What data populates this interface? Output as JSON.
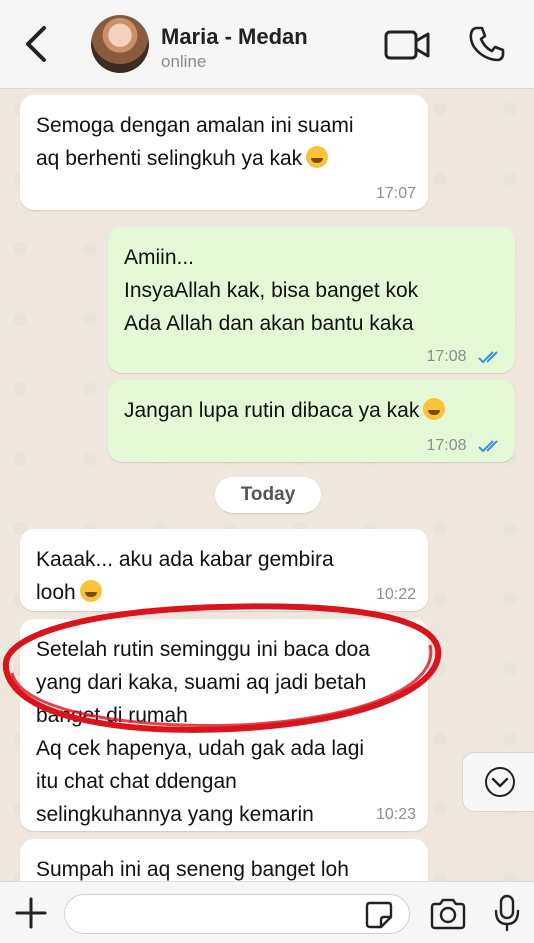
{
  "header": {
    "contact_name": "Maria - Medan",
    "status": "online",
    "icons": [
      "back-chevron-icon",
      "video-call-icon",
      "phone-call-icon"
    ]
  },
  "messages": [
    {
      "direction": "in",
      "lines": [
        "Semoga dengan amalan ini suami",
        "aq berhenti selingkuh ya kak"
      ],
      "emoji": "crying-face",
      "time": "17:07"
    },
    {
      "direction": "out",
      "lines": [
        "Amiin...",
        "InsyaAllah kak, bisa banget kok",
        "Ada Allah dan akan bantu kaka"
      ],
      "time": "17:08",
      "read": true
    },
    {
      "direction": "out",
      "lines": [
        "Jangan lupa rutin dibaca ya kak"
      ],
      "emoji": "smiling-face-with-halo",
      "time": "17:08",
      "read": true
    },
    {
      "direction": "in",
      "lines": [
        "Kaaak... aku ada kabar gembira",
        "looh"
      ],
      "emoji": "grinning-face",
      "time": "10:22"
    },
    {
      "direction": "in",
      "lines": [
        "Setelah rutin seminggu ini baca doa",
        "yang dari kaka, suami aq jadi betah",
        "banget di rumah",
        "Aq cek hapenya, udah gak ada lagi",
        "itu chat chat ddengan",
        "selingkuhannya yang kemarin"
      ],
      "time": "10:23"
    },
    {
      "direction": "in",
      "lines": [
        "Sumpah ini aq seneng banget loh"
      ],
      "time": ""
    }
  ],
  "day_separator": "Today",
  "composer": {
    "placeholder": ""
  },
  "colors": {
    "incoming": "#ffffff",
    "outgoing": "#e4f8d6",
    "read_tick": "#3a8fe0",
    "annotation": "#d9141c"
  }
}
